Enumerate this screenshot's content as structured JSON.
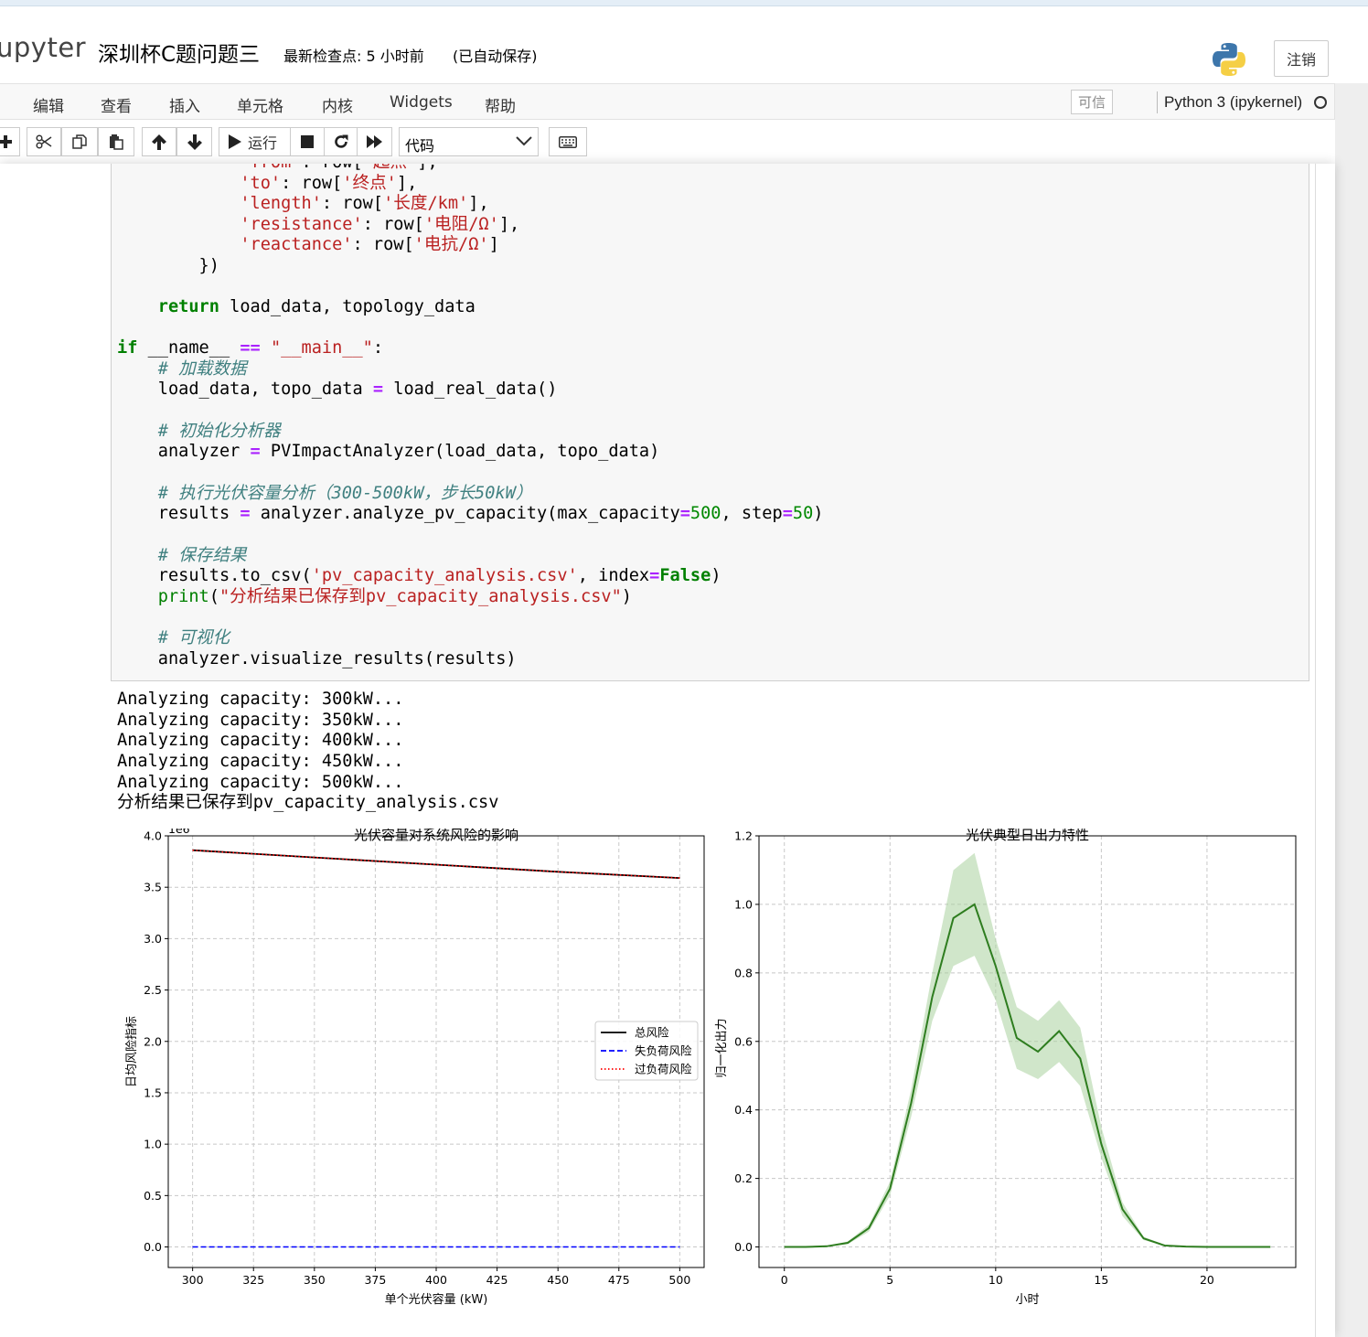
{
  "header": {
    "logo_text": "upyter",
    "notebook_title": "深圳杯C题问题三",
    "checkpoint": "最新检查点: 5 小时前",
    "autosave": "(已自动保存)",
    "logout_label": "注销"
  },
  "menubar": {
    "items": [
      "编辑",
      "查看",
      "插入",
      "单元格",
      "内核",
      "Widgets",
      "帮助"
    ],
    "trusted_label": "可信",
    "kernel_name": "Python 3 (ipykernel)"
  },
  "toolbar": {
    "run_label": "运行",
    "cell_type": "代码"
  },
  "code_lines": [
    "            'from': row['起点'],",
    "            'to': row['终点'],",
    "            'length': row['长度/km'],",
    "            'resistance': row['电阻/Ω'],",
    "            'reactance': row['电抗/Ω']",
    "        })",
    "",
    "    return load_data, topology_data",
    "",
    "if __name__ == \"__main__\":",
    "    # 加载数据",
    "    load_data, topo_data = load_real_data()",
    "",
    "    # 初始化分析器",
    "    analyzer = PVImpactAnalyzer(load_data, topo_data)",
    "",
    "    # 执行光伏容量分析（300-500kW，步长50kW）",
    "    results = analyzer.analyze_pv_capacity(max_capacity=500, step=50)",
    "",
    "    # 保存结果",
    "    results.to_csv('pv_capacity_analysis.csv', index=False)",
    "    print(\"分析结果已保存到pv_capacity_analysis.csv\")",
    "",
    "    # 可视化",
    "    analyzer.visualize_results(results)"
  ],
  "output_lines": [
    "Analyzing capacity: 300kW...",
    "Analyzing capacity: 350kW...",
    "Analyzing capacity: 400kW...",
    "Analyzing capacity: 450kW...",
    "Analyzing capacity: 500kW...",
    "分析结果已保存到pv_capacity_analysis.csv"
  ],
  "chart_data": [
    {
      "type": "line",
      "title": "光伏容量对系统风险的影响",
      "xlabel": "单个光伏容量 (kW)",
      "ylabel": "日均风险指标",
      "y_offset_label": "1e6",
      "xlim": [
        290,
        510
      ],
      "ylim": [
        -0.2,
        4.0
      ],
      "x_ticks": [
        300,
        325,
        350,
        375,
        400,
        425,
        450,
        475,
        500
      ],
      "y_ticks": [
        0.0,
        0.5,
        1.0,
        1.5,
        2.0,
        2.5,
        3.0,
        3.5,
        4.0
      ],
      "x_tick_labels": [
        "300",
        "325",
        "350",
        "375",
        "400",
        "425",
        "450",
        "475",
        "500"
      ],
      "y_tick_labels": [
        "0.0",
        "0.5",
        "1.0",
        "1.5",
        "2.0",
        "2.5",
        "3.0",
        "3.5",
        "4.0"
      ],
      "grid": true,
      "legend_position": "center-right",
      "x": [
        300,
        350,
        400,
        450,
        500
      ],
      "series": [
        {
          "name": "总风险",
          "style": "solid",
          "color": "#000000",
          "values": [
            3.86,
            3.79,
            3.72,
            3.65,
            3.59
          ]
        },
        {
          "name": "失负荷风险",
          "style": "dashed",
          "color": "#0000ff",
          "values": [
            0,
            0,
            0,
            0,
            0
          ]
        },
        {
          "name": "过负荷风险",
          "style": "dotted",
          "color": "#ff0000",
          "values": [
            3.86,
            3.79,
            3.72,
            3.65,
            3.59
          ]
        }
      ]
    },
    {
      "type": "area",
      "title": "光伏典型日出力特性",
      "xlabel": "小时",
      "ylabel": "归一化出力",
      "xlim": [
        -1.2,
        24.2
      ],
      "ylim": [
        -0.06,
        1.2
      ],
      "x_ticks": [
        0,
        5,
        10,
        15,
        20
      ],
      "y_ticks": [
        0.0,
        0.2,
        0.4,
        0.6,
        0.8,
        1.0,
        1.2
      ],
      "x_tick_labels": [
        "0",
        "5",
        "10",
        "15",
        "20"
      ],
      "y_tick_labels": [
        "0.0",
        "0.2",
        "0.4",
        "0.6",
        "0.8",
        "1.0",
        "1.2"
      ],
      "grid": true,
      "line_color": "#2e7d1f",
      "band_color": "#a9d29e",
      "x": [
        0,
        1,
        2,
        3,
        4,
        5,
        6,
        7,
        8,
        9,
        10,
        11,
        12,
        13,
        14,
        15,
        16,
        17,
        18,
        19,
        20,
        21,
        22,
        23
      ],
      "mean": [
        0,
        0,
        0.002,
        0.012,
        0.055,
        0.17,
        0.42,
        0.73,
        0.96,
        1.0,
        0.82,
        0.61,
        0.57,
        0.63,
        0.55,
        0.3,
        0.11,
        0.025,
        0.004,
        0.001,
        0,
        0,
        0,
        0
      ],
      "upper": [
        0,
        0,
        0.003,
        0.016,
        0.065,
        0.19,
        0.46,
        0.8,
        1.1,
        1.15,
        0.9,
        0.7,
        0.66,
        0.72,
        0.64,
        0.35,
        0.13,
        0.03,
        0.006,
        0.002,
        0,
        0,
        0,
        0
      ],
      "lower": [
        0,
        0,
        0.001,
        0.008,
        0.045,
        0.15,
        0.38,
        0.66,
        0.82,
        0.85,
        0.72,
        0.52,
        0.49,
        0.54,
        0.47,
        0.26,
        0.09,
        0.02,
        0.003,
        0.001,
        0,
        0,
        0,
        0
      ]
    }
  ]
}
